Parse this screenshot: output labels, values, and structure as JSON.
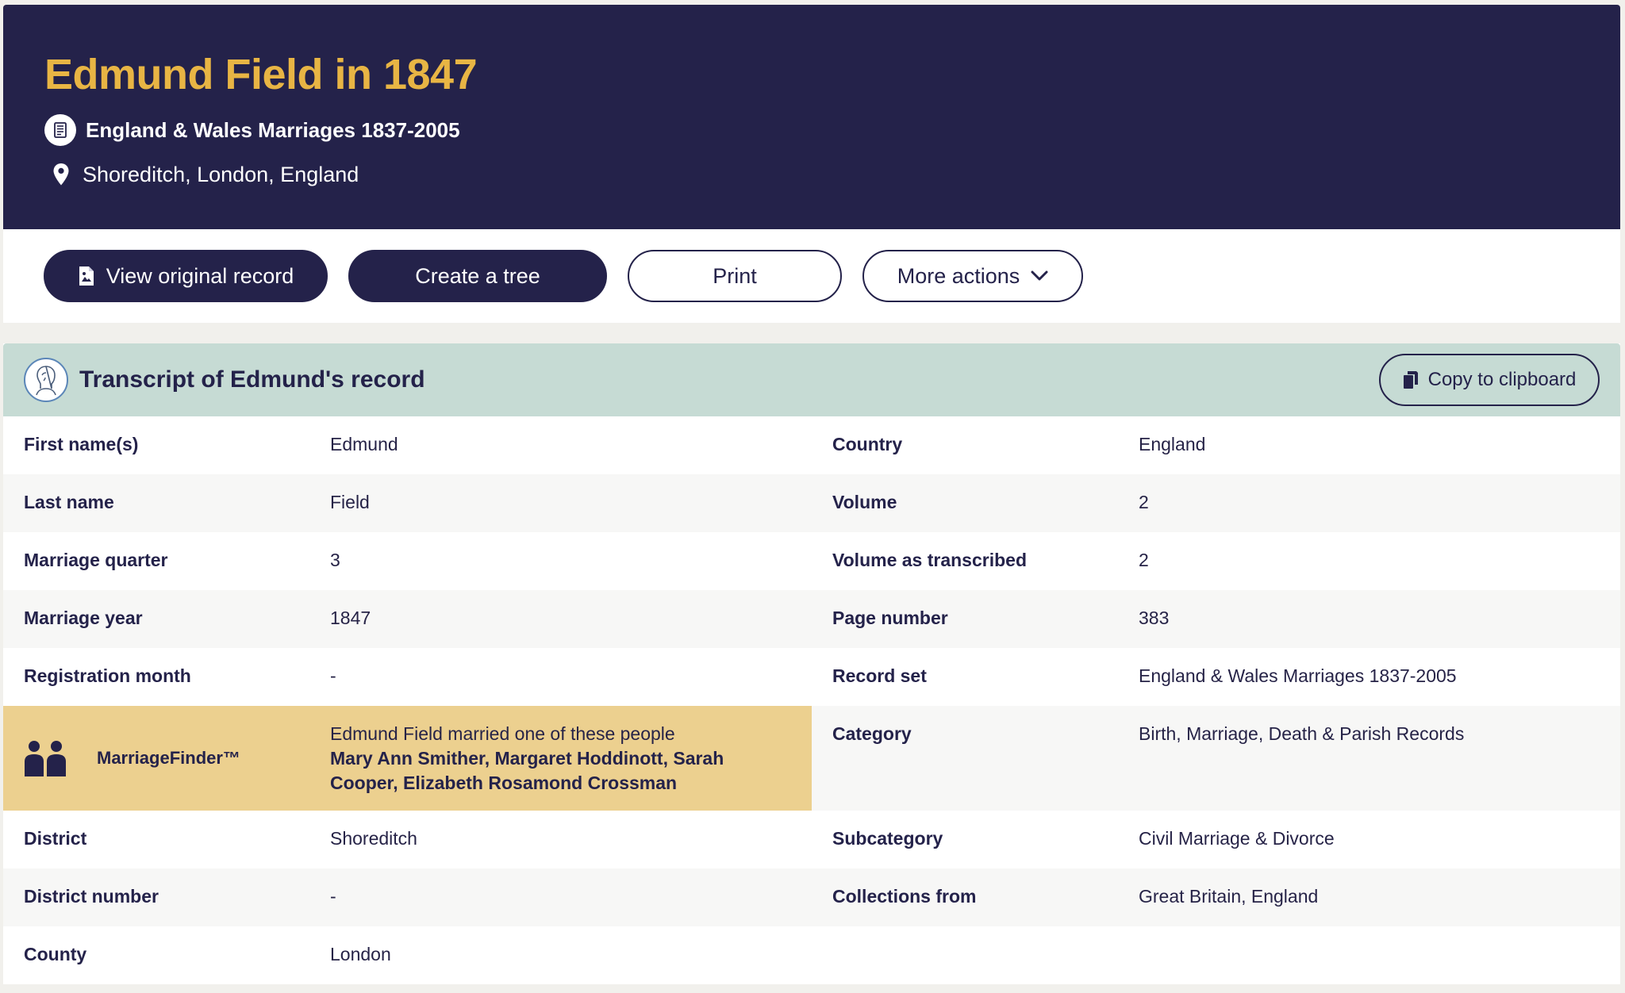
{
  "header": {
    "title": "Edmund Field in 1847",
    "record_set": "England & Wales Marriages 1837-2005",
    "place": "Shoreditch, London, England"
  },
  "actions": {
    "view_original": "View original record",
    "create_tree": "Create a tree",
    "print": "Print",
    "more_actions": "More actions"
  },
  "transcript": {
    "title": "Transcript of Edmund's record",
    "copy_label": "Copy to clipboard",
    "left": [
      {
        "label": "First name(s)",
        "value": "Edmund"
      },
      {
        "label": "Last name",
        "value": "Field"
      },
      {
        "label": "Marriage quarter",
        "value": "3"
      },
      {
        "label": "Marriage year",
        "value": "1847"
      },
      {
        "label": "Registration month",
        "value": "-"
      },
      {
        "label": "District",
        "value": "Shoreditch"
      },
      {
        "label": "District number",
        "value": "-"
      },
      {
        "label": "County",
        "value": "London"
      }
    ],
    "right": [
      {
        "label": "Country",
        "value": "England"
      },
      {
        "label": "Volume",
        "value": "2"
      },
      {
        "label": "Volume as transcribed",
        "value": "2"
      },
      {
        "label": "Page number",
        "value": "383"
      },
      {
        "label": "Record set",
        "value": "England & Wales Marriages 1837-2005"
      },
      {
        "label": "Category",
        "value": "Birth, Marriage, Death & Parish Records"
      },
      {
        "label": "Subcategory",
        "value": "Civil Marriage & Divorce"
      },
      {
        "label": "Collections from",
        "value": "Great Britain, England"
      }
    ],
    "marriage_finder": {
      "label": "MarriageFinder™",
      "intro": "Edmund Field married one of these people",
      "names": "Mary Ann Smither, Margaret Hoddinott, Sarah Cooper, Elizabeth Rosamond Crossman"
    }
  },
  "colors": {
    "header_bg": "#24224a",
    "title": "#e8b544",
    "transcript_header_bg": "#c6dbd4",
    "marriage_finder_bg": "#ecd08f"
  }
}
